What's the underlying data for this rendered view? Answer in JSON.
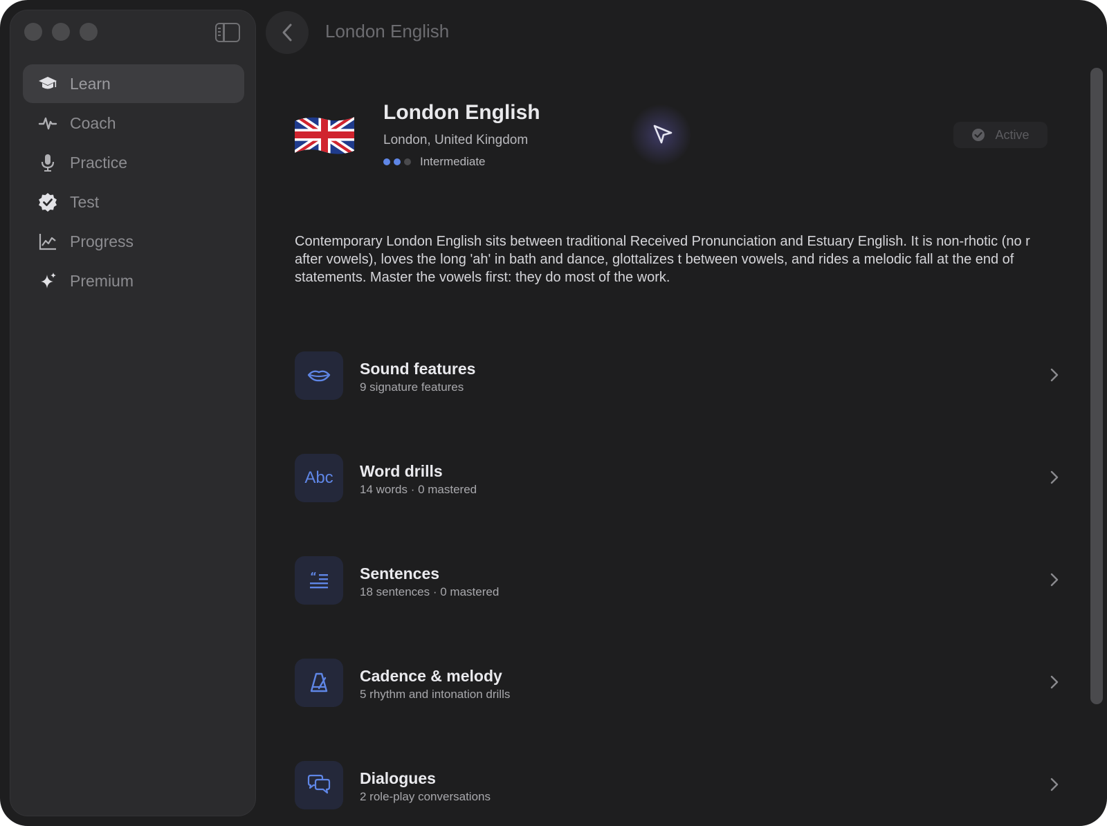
{
  "window": {
    "title": "London English"
  },
  "colors": {
    "accent": "#5f86e6",
    "background": "#1e1e1f",
    "sidebar": "#2b2b2d"
  },
  "sidebar": {
    "items": [
      {
        "label": "Learn",
        "icon": "graduation-cap-icon",
        "active": true
      },
      {
        "label": "Coach",
        "icon": "waveform-icon",
        "active": false
      },
      {
        "label": "Practice",
        "icon": "microphone-icon",
        "active": false
      },
      {
        "label": "Test",
        "icon": "checkmark-seal-icon",
        "active": false
      },
      {
        "label": "Progress",
        "icon": "chart-line-icon",
        "active": false
      },
      {
        "label": "Premium",
        "icon": "sparkles-icon",
        "active": false
      }
    ]
  },
  "header": {
    "name": "London English",
    "location": "London, United Kingdom",
    "level_label": "Intermediate",
    "level_value": 2,
    "level_max": 3,
    "status": "Active",
    "flag_icon": "uk-flag-icon"
  },
  "description": "Contemporary London English sits between traditional Received Pronunciation and Estuary English. It is non-rhotic (no r after vowels), loves the long 'ah' in bath and dance, glottalizes t between vowels, and rides a melodic fall at the end of statements. Master the vowels first: they do most of the work.",
  "sections": [
    {
      "title": "Sound features",
      "subtitle": "9 signature features",
      "icon": "lips-icon"
    },
    {
      "title": "Word drills",
      "subtitle": "14 words · 0 mastered",
      "icon": "abc-icon",
      "tile_text": "Abc"
    },
    {
      "title": "Sentences",
      "subtitle": "18 sentences · 0 mastered",
      "icon": "quote-lines-icon"
    },
    {
      "title": "Cadence & melody",
      "subtitle": "5 rhythm and intonation drills",
      "icon": "metronome-icon"
    },
    {
      "title": "Dialogues",
      "subtitle": "2 role-play conversations",
      "icon": "speech-bubbles-icon"
    }
  ]
}
